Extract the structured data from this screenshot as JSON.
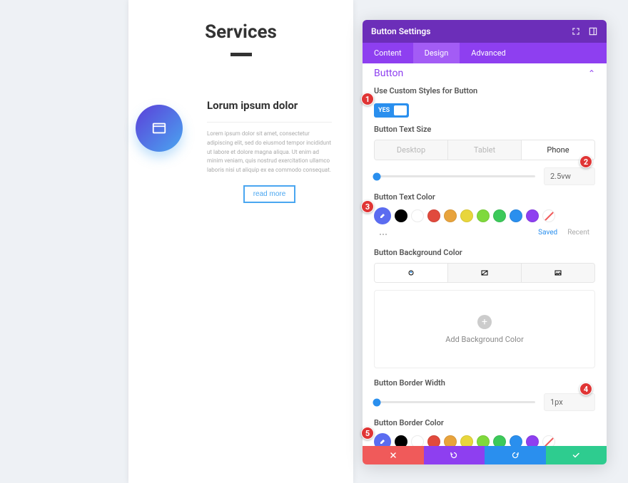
{
  "preview": {
    "title": "Services",
    "card_title": "Lorum ipsum dolor",
    "card_text": "Lorem ipsum dolor sit amet, consectetur adipiscing elit, sed do eiusmod tempor incididunt ut labore et dolore magna aliqua. Ut enim ad minim veniam, quis nostrud exercitation ullamco laboris nisi ut aliquip ex ea commodo consequat.",
    "button_label": "read more"
  },
  "panel": {
    "title": "Button Settings",
    "tabs": {
      "content": "Content",
      "design": "Design",
      "advanced": "Advanced"
    },
    "section": "Button",
    "custom_styles_label": "Use Custom Styles for Button",
    "toggle_yes": "YES",
    "text_size": {
      "label": "Button Text Size",
      "devices": {
        "desktop": "Desktop",
        "tablet": "Tablet",
        "phone": "Phone"
      },
      "value": "2.5vw"
    },
    "text_color": {
      "label": "Button Text Color",
      "saved": "Saved",
      "recent": "Recent"
    },
    "bg_color": {
      "label": "Button Background Color",
      "add": "Add Background Color"
    },
    "border_width": {
      "label": "Button Border Width",
      "value": "1px"
    },
    "border_color": {
      "label": "Button Border Color"
    },
    "colors": {
      "active": "#5b6cf0",
      "black": "#000000",
      "white": "#ffffff",
      "red": "#e14a3d",
      "orange": "#e8a33c",
      "yellow": "#e8d63c",
      "lime": "#7fd93c",
      "green": "#3cc95a",
      "blue": "#2a8fee",
      "purple": "#8e3ff0"
    }
  },
  "badges": [
    "1",
    "2",
    "3",
    "4",
    "5"
  ]
}
